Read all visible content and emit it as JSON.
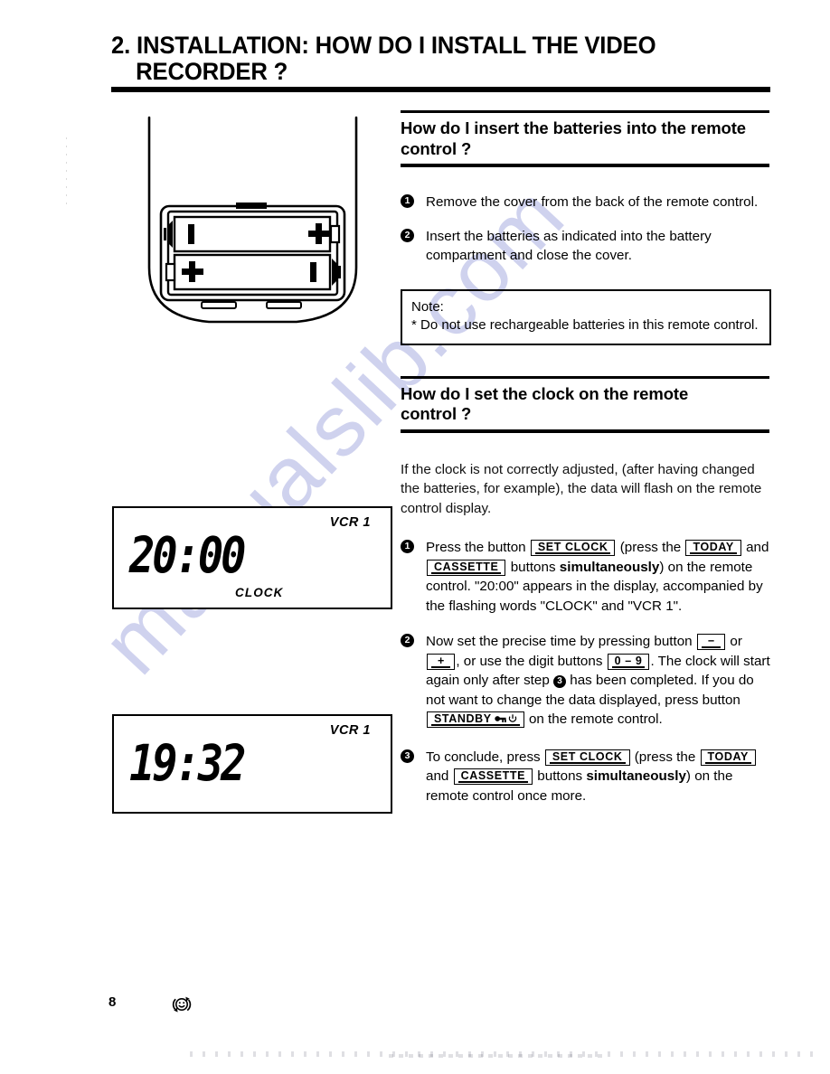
{
  "page": {
    "number": "8",
    "watermark": "manualslib.com"
  },
  "chapter": {
    "line1": "2. INSTALLATION: HOW DO I INSTALL THE VIDEO",
    "line2": "RECORDER ?"
  },
  "sections": [
    {
      "title_line1": "How do I insert the batteries into the remote",
      "title_line2": "control ?",
      "steps": [
        {
          "num": "1",
          "text": "Remove the cover from the back of the remote control."
        },
        {
          "num": "2",
          "text": "Insert the batteries as indicated into the battery compartment and close the cover."
        }
      ],
      "note": {
        "title": "Note:",
        "item": "* Do not use rechargeable batteries in this remote control."
      }
    },
    {
      "title_line1": "How do I set the clock on the remote",
      "title_line2": "control ?",
      "intro": "If the clock is not correctly adjusted, (after having changed the batteries, for example), the data will flash on the remote control display.",
      "steps": [
        {
          "num": "1",
          "t1": "Press the button",
          "key1": "SET CLOCK",
          "t2": "(press the",
          "key2": "TODAY",
          "t3": "and",
          "key3": "CASSETTE",
          "t4": "buttons",
          "bold1": "simultaneously",
          "t5": ") on the remote control. \"20:00\" appears in the display, accompanied by the flashing words \"CLOCK\" and \"VCR 1\"."
        },
        {
          "num": "2",
          "t1": "Now set the precise time by pressing button",
          "key1": "−",
          "t2": "or",
          "key2": "+",
          "t3": ", or use the digit buttons",
          "key3": "0 – 9",
          "t4": ". The clock will start again only after step",
          "inline_num": "3",
          "t5": "has been completed.",
          "t6": "If you do not want to change the data displayed, press button",
          "key4": "STANDBY",
          "key4_icons": "key-icon power-icon",
          "t7": "on the remote control."
        },
        {
          "num": "3",
          "t1": "To conclude, press",
          "key1": "SET CLOCK",
          "t2": "(press the",
          "key2": "TODAY",
          "t3": "and",
          "key3": "CASSETTE",
          "t4": "buttons",
          "bold1": "simultaneously",
          "t5": ") on the remote control once more."
        }
      ]
    }
  ],
  "figures": {
    "remote": {
      "name": "remote-control-back-battery-compartment",
      "battery_top_minus": "I",
      "battery_top_plus": "+",
      "battery_bottom_plus": "+",
      "battery_bottom_minus": "I"
    },
    "lcd1": {
      "vcr": "VCR 1",
      "time": "20:00",
      "mode": "CLOCK"
    },
    "lcd2": {
      "vcr": "VCR 1",
      "time": "19:32",
      "mode": ""
    }
  },
  "footer": {
    "icon": "smiley-refresh-icon"
  }
}
